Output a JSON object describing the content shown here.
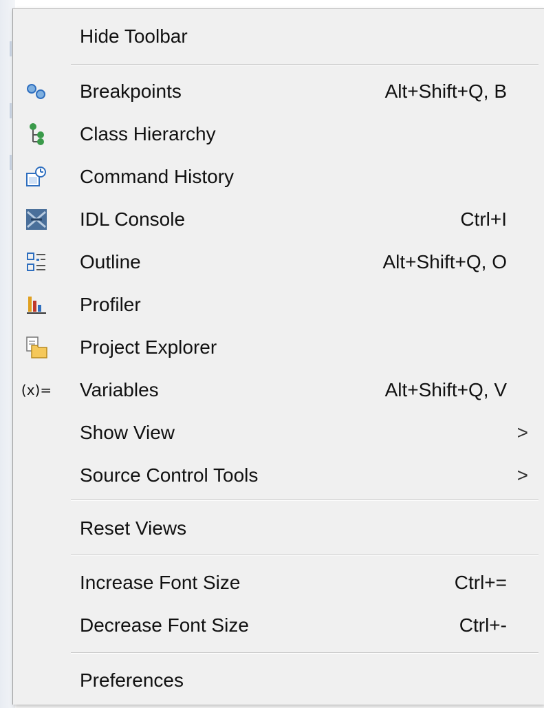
{
  "menu": {
    "items": [
      {
        "label": "Hide Toolbar",
        "shortcut": "",
        "icon": ""
      },
      {
        "label": "Breakpoints",
        "shortcut": "Alt+Shift+Q, B",
        "icon": "breakpoints-icon"
      },
      {
        "label": "Class Hierarchy",
        "shortcut": "",
        "icon": "class-hierarchy-icon"
      },
      {
        "label": "Command History",
        "shortcut": "",
        "icon": "command-history-icon"
      },
      {
        "label": "IDL Console",
        "shortcut": "Ctrl+I",
        "icon": "idl-console-icon"
      },
      {
        "label": "Outline",
        "shortcut": "Alt+Shift+Q, O",
        "icon": "outline-icon"
      },
      {
        "label": "Profiler",
        "shortcut": "",
        "icon": "profiler-icon"
      },
      {
        "label": "Project Explorer",
        "shortcut": "",
        "icon": "project-explorer-icon"
      },
      {
        "label": "Variables",
        "shortcut": "Alt+Shift+Q, V",
        "icon": "variables-icon",
        "icon_text": "(x)="
      },
      {
        "label": "Show View",
        "shortcut": "",
        "submenu_arrow": ">"
      },
      {
        "label": "Source Control Tools",
        "shortcut": "",
        "submenu_arrow": ">"
      },
      {
        "label": "Reset Views",
        "shortcut": ""
      },
      {
        "label": "Increase Font Size",
        "shortcut": "Ctrl+="
      },
      {
        "label": "Decrease Font Size",
        "shortcut": "Ctrl+-"
      },
      {
        "label": "Preferences",
        "shortcut": ""
      }
    ]
  },
  "colors": {
    "menu_background": "#f0f0f0",
    "separator": "#c8c8c8",
    "text": "#111111",
    "accent_blue": "#3d7bc7",
    "accent_green": "#3a9a4a"
  }
}
